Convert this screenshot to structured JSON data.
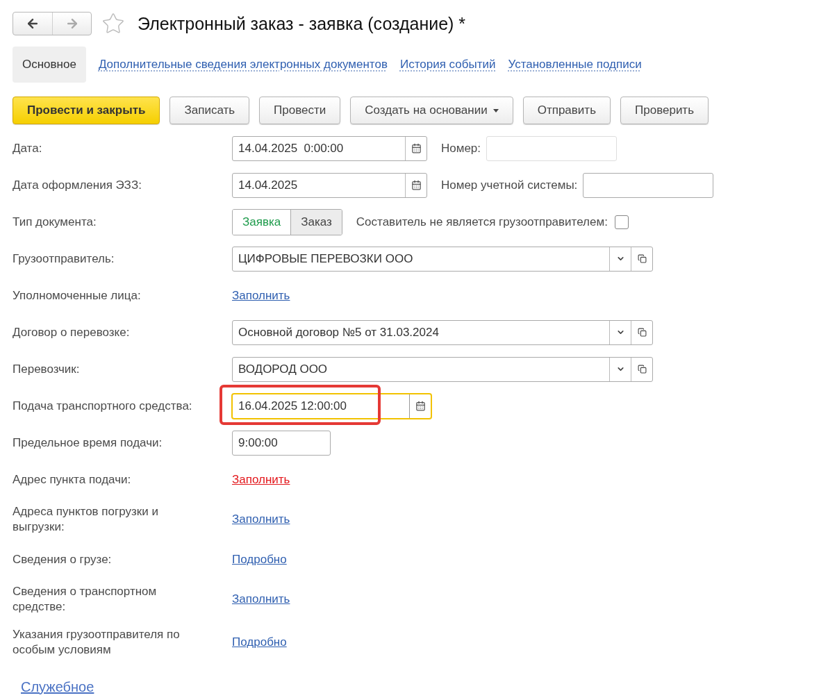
{
  "header": {
    "title": "Электронный заказ - заявка (создание) *",
    "favorite": false
  },
  "tabs": [
    {
      "label": "Основное",
      "selected": true
    },
    {
      "label": "Дополнительные сведения электронных документов",
      "selected": false
    },
    {
      "label": "История событий",
      "selected": false
    },
    {
      "label": "Установленные подписи",
      "selected": false
    }
  ],
  "toolbar": [
    {
      "label": "Провести и закрыть",
      "kind": "primary"
    },
    {
      "label": "Записать",
      "kind": "default"
    },
    {
      "label": "Провести",
      "kind": "default"
    },
    {
      "label": "Создать на основании",
      "kind": "dropdown"
    },
    {
      "label": "Отправить",
      "kind": "default"
    },
    {
      "label": "Проверить",
      "kind": "default"
    }
  ],
  "fields": [
    {
      "kind": "date",
      "label": "Дата:",
      "value": "14.04.2025  0:00:00",
      "side": {
        "kind": "input",
        "label": "Номер:",
        "disabled": true
      }
    },
    {
      "kind": "date",
      "label": "Дата оформления ЭЗЗ:",
      "value": "14.04.2025",
      "side": {
        "kind": "input",
        "label": "Номер учетной системы:",
        "disabled": false
      }
    },
    {
      "kind": "toggle",
      "label": "Тип документа:",
      "options": [
        {
          "label": "Заявка",
          "selected": true
        },
        {
          "label": "Заказ",
          "selected": false
        }
      ],
      "side": {
        "kind": "checkbox",
        "label": "Составитель не является грузоотправителем:",
        "checked": false
      }
    },
    {
      "kind": "select",
      "label": "Грузоотправитель:",
      "value": "ЦИФРОВЫЕ ПЕРЕВОЗКИ ООО"
    },
    {
      "kind": "link",
      "label": "Уполномоченные лица:",
      "link": "Заполнить",
      "warning": false
    },
    {
      "kind": "select",
      "label": "Договор о перевозке:",
      "value": "Основной договор №5 от 31.03.2024"
    },
    {
      "kind": "select",
      "label": "Перевозчик:",
      "value": "ВОДОРОД ООО"
    },
    {
      "kind": "datetime",
      "label": "Подача транспортного средства:",
      "value": "16.04.2025 12:00:00",
      "focused": true,
      "highlighted": true
    },
    {
      "kind": "time",
      "label": "Предельное время подачи:",
      "value": "9:00:00"
    },
    {
      "kind": "link",
      "label": "Адрес пункта подачи:",
      "link": "Заполнить",
      "warning": true
    },
    {
      "kind": "link",
      "label": "Адреса пунктов погрузки и выгрузки:",
      "link": "Заполнить",
      "warning": false
    },
    {
      "kind": "link",
      "label": "Сведения о грузе:",
      "link": "Подробно",
      "warning": false
    },
    {
      "kind": "link",
      "label": "Сведения о транспортном средстве:",
      "link": "Заполнить",
      "warning": false
    },
    {
      "kind": "link",
      "label": "Указания грузоотправителя по особым условиям",
      "link": "Подробно",
      "warning": false
    }
  ],
  "footer_link": "Служебное"
}
